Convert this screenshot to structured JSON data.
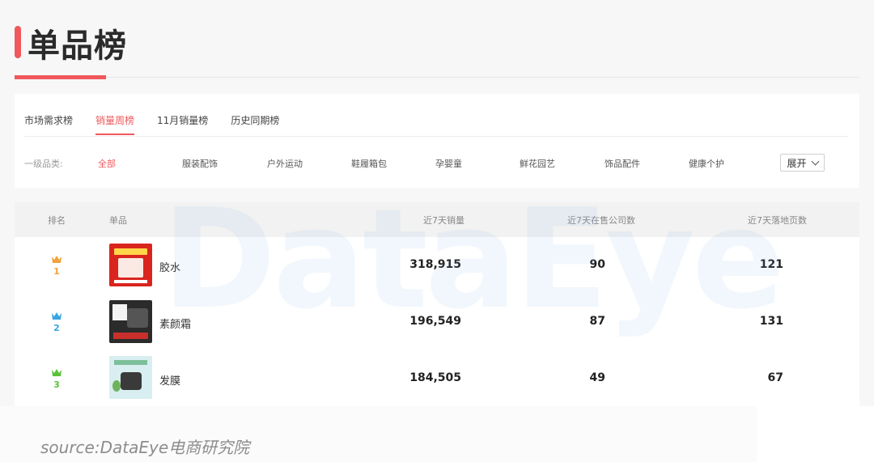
{
  "header": {
    "title": "单品榜"
  },
  "tabs": [
    {
      "label": "市场需求榜",
      "active": false
    },
    {
      "label": "销量周榜",
      "active": true
    },
    {
      "label": "11月销量榜",
      "active": false
    },
    {
      "label": "历史同期榜",
      "active": false
    }
  ],
  "category_filter": {
    "label": "一级品类:",
    "items": [
      {
        "label": "全部",
        "active": true
      },
      {
        "label": "服装配饰",
        "active": false
      },
      {
        "label": "户外运动",
        "active": false
      },
      {
        "label": "鞋履箱包",
        "active": false
      },
      {
        "label": "孕婴童",
        "active": false
      },
      {
        "label": "鲜花园艺",
        "active": false
      },
      {
        "label": "饰品配件",
        "active": false
      },
      {
        "label": "健康个护",
        "active": false
      }
    ],
    "expand_label": "展开"
  },
  "table": {
    "columns": {
      "rank": "排名",
      "product": "单品",
      "sales": "近7天销量",
      "companies": "近7天在售公司数",
      "pages": "近7天落地页数"
    },
    "rows": [
      {
        "rank": "1",
        "name": "胶水",
        "sales": "318,915",
        "companies": "90",
        "pages": "121",
        "rank_color": "#f2a338",
        "thumb_color": "#d9251e"
      },
      {
        "rank": "2",
        "name": "素颜霜",
        "sales": "196,549",
        "companies": "87",
        "pages": "131",
        "rank_color": "#3aa6e3",
        "thumb_color": "#2b2b2b"
      },
      {
        "rank": "3",
        "name": "发膜",
        "sales": "184,505",
        "companies": "49",
        "pages": "67",
        "rank_color": "#5bc23a",
        "thumb_color": "#d8eef0"
      }
    ]
  },
  "watermark": "DataEye",
  "footer": {
    "source": "source:DataEye电商研究院"
  },
  "colors": {
    "accent": "#f0585c"
  }
}
